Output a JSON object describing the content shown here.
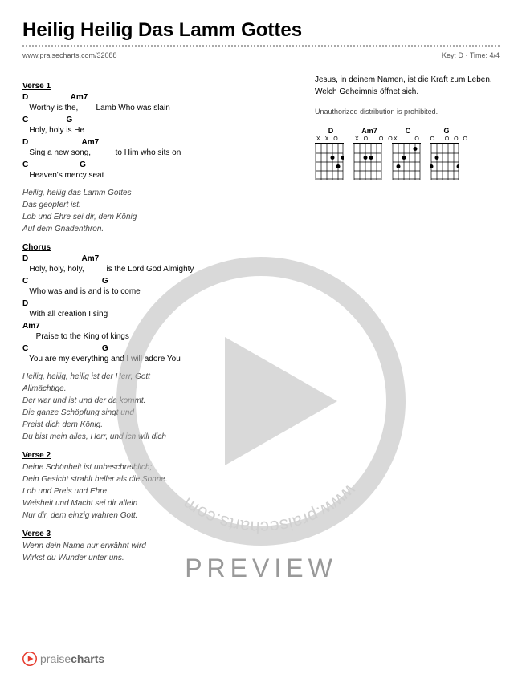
{
  "title": "Heilig Heilig Das Lamm Gottes",
  "source_url": "www.praisecharts.com/32088",
  "key_label": "Key: D · Time: 4/4",
  "sections": [
    {
      "label": "Verse 1",
      "lines": [
        {
          "chords": "D                   Am7",
          "lyric": "   Worthy is the,        Lamb Who was slain"
        },
        {
          "chords": "C                 G",
          "lyric": "   Holy, holy is He"
        },
        {
          "chords": "D                        Am7",
          "lyric": "   Sing a new song,           to Him who sits on"
        },
        {
          "chords": "C                       G",
          "lyric": "   Heaven's mercy seat"
        }
      ],
      "translation": "Heilig, heilig das Lamm Gottes\nDas geopfert ist.\nLob und Ehre sei dir, dem König\nAuf dem Gnadenthron."
    },
    {
      "label": "Chorus",
      "lines": [
        {
          "chords": "D                        Am7",
          "lyric": "   Holy, holy, holy,          is the Lord God Almighty"
        },
        {
          "chords": "C                                 G",
          "lyric": "   Who was and is and is to come"
        },
        {
          "chords": "D",
          "lyric": "   With all creation I sing"
        },
        {
          "chords": "Am7",
          "lyric": "      Praise to the King of kings"
        },
        {
          "chords": "C                                 G",
          "lyric": "   You are my everything and I will adore You"
        }
      ],
      "translation": "Heilig, heilig, heilig ist der Herr, Gott\nAllmächtige.\nDer war und ist und der da kommt.\nDie ganze Schöpfung singt und\nPreist dich dem König.\nDu bist mein alles, Herr, und ich will dich"
    },
    {
      "label": "Verse 2",
      "translation": "Deine Schönheit ist unbeschreiblich;\nDein Gesicht strahlt heller als die Sonne.\nLob und Preis und Ehre\nWeisheit und Macht sei dir allein\nNur dir, dem einzig wahren Gott."
    },
    {
      "label": "Verse 3",
      "translation": "Wenn dein Name nur erwähnt wird\nWirkst du Wunder unter uns."
    }
  ],
  "right_column": {
    "continuation": "Jesus, in deinem Namen, ist die Kraft zum Leben.\nWelch Geheimnis öffnet sich.",
    "copyright": "Unauthorized distribution is prohibited."
  },
  "chord_diagrams": [
    {
      "name": "D",
      "marks": "X X O"
    },
    {
      "name": "Am7",
      "marks": "X O   O O"
    },
    {
      "name": "C",
      "marks": "X     O   O"
    },
    {
      "name": "G",
      "marks": "    O O O"
    }
  ],
  "preview_text": "PREVIEW",
  "watermark_text": "www.praisecharts.com",
  "footer_brand_light": "praise",
  "footer_brand_bold": "charts",
  "colors": {
    "accent": "#e63b2e",
    "watermark_gray": "#999999"
  }
}
